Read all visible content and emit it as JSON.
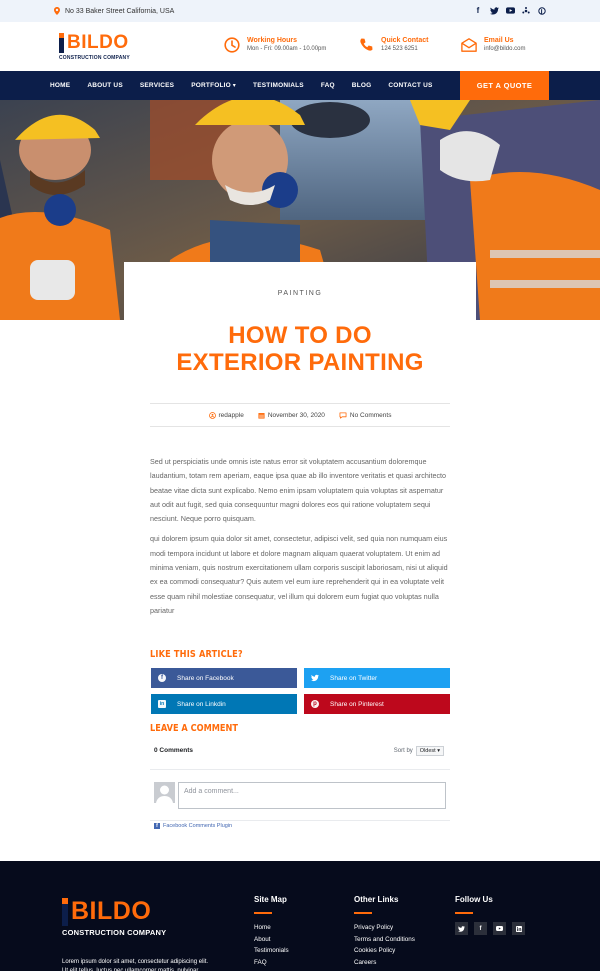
{
  "topbar": {
    "address": "No 33 Baker Street California, USA",
    "social_icons": [
      "facebook-icon",
      "twitter-icon",
      "youtube-icon",
      "yelp-icon",
      "pinterest-icon"
    ]
  },
  "header": {
    "logo_text": "BILDO",
    "logo_sub": "CONSTRUCTION COMPANY",
    "working_hours_title": "Working Hours",
    "working_hours_value": "Mon - Fri: 09.00am - 10.00pm",
    "contact_title": "Quick Contact",
    "contact_value": "124 523 6251",
    "email_title": "Email Us",
    "email_value": "info@bildo.com"
  },
  "nav": {
    "items": [
      "HOME",
      "ABOUT US",
      "SERVICES",
      "PORTFOLIO",
      "TESTIMONIALS",
      "FAQ",
      "BLOG",
      "CONTACT US"
    ],
    "quote_button": "GET A QUOTE"
  },
  "post": {
    "category": "PAINTING",
    "title_line1": "HOW TO DO",
    "title_line2": "EXTERIOR PAINTING",
    "author": "redapple",
    "date": "November 30, 2020",
    "comments": "No Comments",
    "paragraph1": "Sed ut perspiciatis unde omnis iste natus error sit voluptatem accusantium doloremque laudantium, totam rem aperiam, eaque ipsa quae ab illo inventore veritatis et quasi architecto beatae vitae dicta sunt explicabo. Nemo enim ipsam voluptatem quia voluptas sit aspernatur aut odit aut fugit, sed quia consequuntur magni dolores eos qui ratione voluptatem sequi nesciunt. Neque porro quisquam.",
    "paragraph2": "qui dolorem ipsum quia dolor sit amet, consectetur, adipisci velit, sed quia non numquam eius modi tempora incidunt ut labore et dolore magnam aliquam quaerat voluptatem. Ut enim ad minima veniam, quis nostrum exercitationem ullam corporis suscipit laboriosam, nisi ut aliquid ex ea commodi consequatur? Quis autem vel eum iure reprehenderit qui in ea voluptate velit esse quam nihil molestiae consequatur, vel illum qui dolorem eum fugiat quo voluptas nulla pariatur"
  },
  "share": {
    "heading": "LIKE THIS ARTICLE?",
    "facebook": "Share on Facebook",
    "twitter": "Share on Twitter",
    "linkedin": "Share on Linkdin",
    "pinterest": "Share on Pinterest",
    "colors": {
      "facebook": "#3b5998",
      "twitter": "#1da1f2",
      "linkedin": "#0077b5",
      "pinterest": "#bd081c"
    }
  },
  "comments": {
    "heading": "LEAVE A COMMENT",
    "count": "0 Comments",
    "sort_label": "Sort by",
    "sort_value": "Oldest",
    "placeholder": "Add a comment...",
    "plugin_label": "Facebook Comments Plugin"
  },
  "footer": {
    "logo_text": "BILDO",
    "logo_sub": "CONSTRUCTION COMPANY",
    "description": "Lorem ipsum dolor sit amet, consectetur adipiscing elit. Ut elit tellus, luctus nec ullamcorper mattis, pulvinar.",
    "sitemap_title": "Site Map",
    "sitemap_links": [
      "Home",
      "About",
      "Testimonials",
      "FAQ"
    ],
    "other_title": "Other Links",
    "other_links": [
      "Privacy Policy",
      "Terms and Conditions",
      "Cookies Policy",
      "Careers"
    ],
    "follow_title": "Follow Us",
    "follow_icons": [
      "twitter-icon",
      "facebook-icon",
      "youtube-icon",
      "linkedin-icon"
    ]
  },
  "colors": {
    "accent": "#ff6b0b",
    "navy": "#0c1e4a",
    "footer": "#060b1c"
  }
}
